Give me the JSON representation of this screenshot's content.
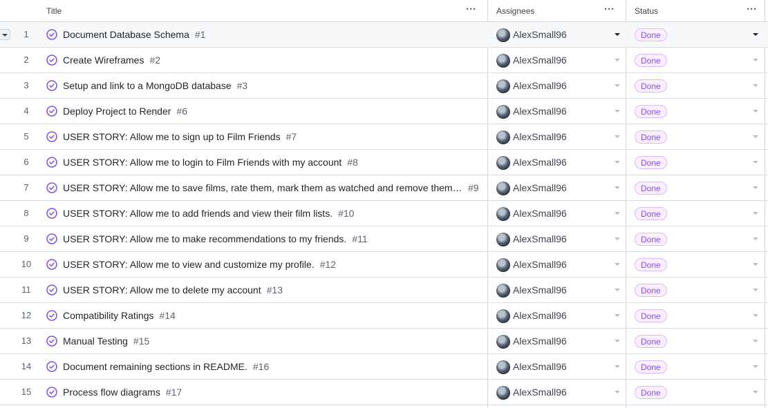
{
  "header": {
    "title_label": "Title",
    "assignees_label": "Assignees",
    "status_label": "Status",
    "menu_glyph": "···"
  },
  "colors": {
    "done_text": "#8250df",
    "done_bg": "#fbefff",
    "done_border": "#d8b9ff",
    "issue_icon": "#8250df"
  },
  "icons": {
    "issue_status": "check-circle-icon",
    "row_expander": "chevron-down-icon",
    "dropdown": "triangle-down-icon",
    "column_menu": "kebab-horizontal-icon"
  },
  "rows": [
    {
      "num": "1",
      "title": "Document Database Schema",
      "issue": "#1",
      "assignee": "AlexSmall96",
      "status": "Done"
    },
    {
      "num": "2",
      "title": "Create Wireframes",
      "issue": "#2",
      "assignee": "AlexSmall96",
      "status": "Done"
    },
    {
      "num": "3",
      "title": "Setup and link to a MongoDB database",
      "issue": "#3",
      "assignee": "AlexSmall96",
      "status": "Done"
    },
    {
      "num": "4",
      "title": "Deploy Project to Render",
      "issue": "#6",
      "assignee": "AlexSmall96",
      "status": "Done"
    },
    {
      "num": "5",
      "title": "USER STORY: Allow me to sign up to Film Friends",
      "issue": "#7",
      "assignee": "AlexSmall96",
      "status": "Done"
    },
    {
      "num": "6",
      "title": "USER STORY: Allow me to login to Film Friends with my account",
      "issue": "#8",
      "assignee": "AlexSmall96",
      "status": "Done"
    },
    {
      "num": "7",
      "title": "USER STORY: Allow me to save films, rate them, mark them as watched and remove them fr...",
      "issue": "#9",
      "assignee": "AlexSmall96",
      "status": "Done"
    },
    {
      "num": "8",
      "title": "USER STORY: Allow me to add friends and view their film lists.",
      "issue": "#10",
      "assignee": "AlexSmall96",
      "status": "Done"
    },
    {
      "num": "9",
      "title": "USER STORY: Allow me to make recommendations to my friends.",
      "issue": "#11",
      "assignee": "AlexSmall96",
      "status": "Done"
    },
    {
      "num": "10",
      "title": "USER STORY: Allow me to view and customize my profile.",
      "issue": "#12",
      "assignee": "AlexSmall96",
      "status": "Done"
    },
    {
      "num": "11",
      "title": "USER STORY: Allow me to delete my account",
      "issue": "#13",
      "assignee": "AlexSmall96",
      "status": "Done"
    },
    {
      "num": "12",
      "title": "Compatibility Ratings",
      "issue": "#14",
      "assignee": "AlexSmall96",
      "status": "Done"
    },
    {
      "num": "13",
      "title": "Manual Testing",
      "issue": "#15",
      "assignee": "AlexSmall96",
      "status": "Done"
    },
    {
      "num": "14",
      "title": "Document remaining sections in README.",
      "issue": "#16",
      "assignee": "AlexSmall96",
      "status": "Done"
    },
    {
      "num": "15",
      "title": "Process flow diagrams",
      "issue": "#17",
      "assignee": "AlexSmall96",
      "status": "Done"
    }
  ]
}
